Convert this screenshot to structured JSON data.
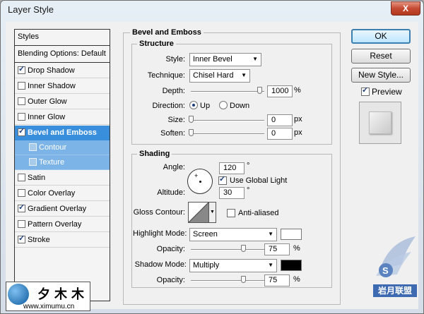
{
  "window": {
    "title": "Layer Style",
    "close": "X"
  },
  "style_list": {
    "header": "Styles",
    "blending": "Blending Options: Default",
    "items": [
      {
        "label": "Drop Shadow",
        "checked": true
      },
      {
        "label": "Inner Shadow",
        "checked": false
      },
      {
        "label": "Outer Glow",
        "checked": false
      },
      {
        "label": "Inner Glow",
        "checked": false
      },
      {
        "label": "Bevel and Emboss",
        "checked": true
      },
      {
        "label": "Contour",
        "checked": false
      },
      {
        "label": "Texture",
        "checked": false
      },
      {
        "label": "Satin",
        "checked": false
      },
      {
        "label": "Color Overlay",
        "checked": false
      },
      {
        "label": "Gradient Overlay",
        "checked": true
      },
      {
        "label": "Pattern Overlay",
        "checked": false
      },
      {
        "label": "Stroke",
        "checked": true
      }
    ]
  },
  "bevel": {
    "title": "Bevel and Emboss",
    "structure": {
      "title": "Structure",
      "style_label": "Style:",
      "style_value": "Inner Bevel",
      "technique_label": "Technique:",
      "technique_value": "Chisel Hard",
      "depth_label": "Depth:",
      "depth_value": "1000",
      "depth_unit": "%",
      "depth_level": 1.0,
      "direction_label": "Direction:",
      "dir_up": "Up",
      "dir_down": "Down",
      "direction_selected": "Up",
      "size_label": "Size:",
      "size_value": "0",
      "size_unit": "px",
      "soften_label": "Soften:",
      "soften_value": "0",
      "soften_unit": "px"
    },
    "shading": {
      "title": "Shading",
      "angle_label": "Angle:",
      "angle_value": "120",
      "angle_unit": "°",
      "use_global_light": "Use Global Light",
      "use_global_light_checked": true,
      "altitude_label": "Altitude:",
      "altitude_value": "30",
      "altitude_unit": "°",
      "gloss_contour_label": "Gloss Contour:",
      "anti_aliased": "Anti-aliased",
      "anti_aliased_checked": false,
      "highlight_mode_label": "Highlight Mode:",
      "highlight_mode_value": "Screen",
      "highlight_color": "#ffffff",
      "highlight_opacity_label": "Opacity:",
      "highlight_opacity_value": "75",
      "highlight_opacity_unit": "%",
      "shadow_mode_label": "Shadow Mode:",
      "shadow_mode_value": "Multiply",
      "shadow_color": "#000000",
      "shadow_opacity_label": "Opacity:",
      "shadow_opacity_value": "75",
      "shadow_opacity_unit": "%"
    }
  },
  "buttons": {
    "ok": "OK",
    "reset": "Reset",
    "new_style": "New Style...",
    "preview": "Preview",
    "preview_checked": true
  },
  "watermark": {
    "brand": "夕木木",
    "url": "www.ximumu.cn",
    "badge": "岩月联盟"
  },
  "colors": {
    "selected_row": "#3a8fdc",
    "sub_row": "#7db4e8",
    "button_focus": "#3c7fb1"
  }
}
